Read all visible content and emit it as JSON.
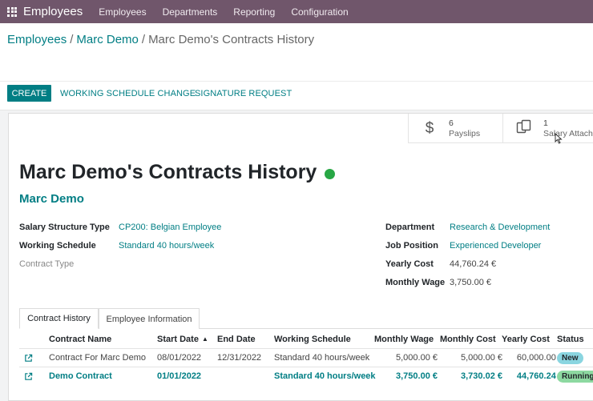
{
  "navbar": {
    "app_name": "Employees",
    "menu": [
      "Employees",
      "Departments",
      "Reporting",
      "Configuration"
    ]
  },
  "breadcrumb": {
    "items": [
      "Employees",
      "Marc Demo"
    ],
    "current": "Marc Demo's Contracts History"
  },
  "actions": {
    "create": "CREATE",
    "working_schedule_change": "WORKING SCHEDULE CHANGE",
    "signature_request": "SIGNATURE REQUEST"
  },
  "smart_buttons": [
    {
      "value": "6",
      "label": "Payslips",
      "icon": "dollar-icon"
    },
    {
      "value": "1",
      "label": "Salary Attach...",
      "icon": "documents-icon"
    }
  ],
  "record": {
    "title": "Marc Demo's Contracts History",
    "status_color": "#28a745",
    "employee": "Marc Demo"
  },
  "fields_left": [
    {
      "label": "Salary Structure Type",
      "value": "CP200: Belgian Employee"
    },
    {
      "label": "Working Schedule",
      "value": "Standard 40 hours/week"
    },
    {
      "label": "Contract Type",
      "value": ""
    }
  ],
  "fields_right": [
    {
      "label": "Department",
      "value": "Research & Development"
    },
    {
      "label": "Job Position",
      "value": "Experienced Developer"
    },
    {
      "label": "Yearly Cost",
      "value": "44,760.24 €"
    },
    {
      "label": "Monthly Wage",
      "value": "3,750.00 €"
    }
  ],
  "tabs": [
    "Contract History",
    "Employee Information"
  ],
  "table": {
    "columns": [
      "Contract Name",
      "Start Date",
      "End Date",
      "Working Schedule",
      "Monthly Wage",
      "Monthly Cost",
      "Yearly Cost",
      "Status"
    ],
    "rows": [
      {
        "name": "Contract For Marc Demo",
        "start": "08/01/2022",
        "end": "12/31/2022",
        "schedule": "Standard 40 hours/week",
        "wage": "5,000.00 €",
        "monthly_cost": "5,000.00 €",
        "yearly_cost": "60,000.00 €",
        "status": "New"
      },
      {
        "name": "Demo Contract",
        "start": "01/01/2022",
        "end": "",
        "schedule": "Standard 40 hours/week",
        "wage": "3,750.00 €",
        "monthly_cost": "3,730.02 €",
        "yearly_cost": "44,760.24 €",
        "status": "Running"
      }
    ]
  },
  "colors": {
    "navbar": "#70566b",
    "primary": "#017e84"
  }
}
